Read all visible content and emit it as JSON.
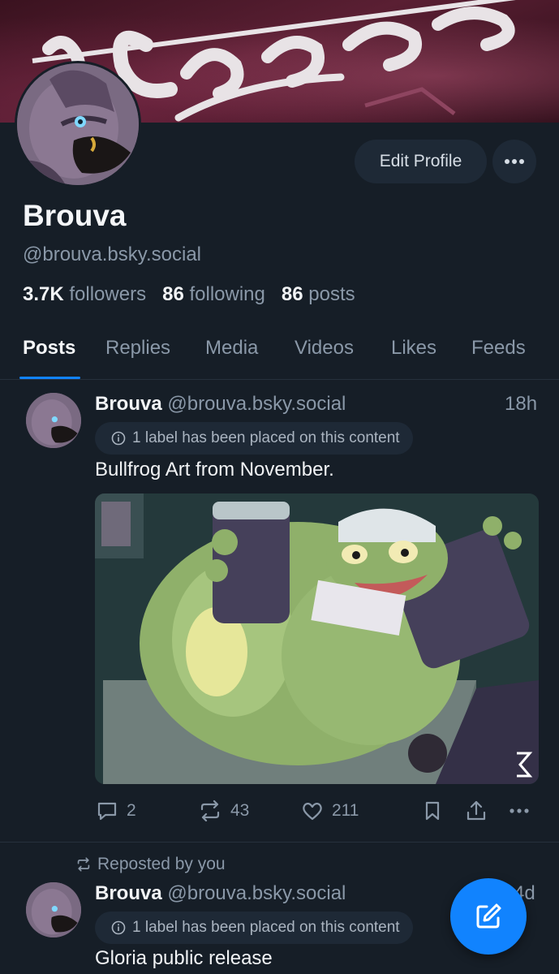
{
  "profile": {
    "name": "Brouva",
    "handle": "@brouva.bsky.social",
    "followers_count": "3.7K",
    "followers_label": "followers",
    "following_count": "86",
    "following_label": "following",
    "posts_count": "86",
    "posts_label": "posts",
    "edit_label": "Edit Profile"
  },
  "tabs": [
    {
      "label": "Posts",
      "active": true
    },
    {
      "label": "Replies"
    },
    {
      "label": "Media"
    },
    {
      "label": "Videos"
    },
    {
      "label": "Likes"
    },
    {
      "label": "Feeds"
    }
  ],
  "posts": [
    {
      "author": "Brouva",
      "handle": "@brouva.bsky.social",
      "time": "18h",
      "label": "1 label has been placed on this content",
      "text": "Bullfrog Art from November.",
      "replies": "2",
      "reposts": "43",
      "likes": "211"
    },
    {
      "repost_note": "Reposted by you",
      "author": "Brouva",
      "handle": "@brouva.bsky.social",
      "time": "4d",
      "label": "1 label has been placed on this content",
      "text": "Gloria public release"
    }
  ],
  "colors": {
    "background": "#161e27",
    "accent": "#1183fe",
    "muted": "#8a98a8"
  }
}
